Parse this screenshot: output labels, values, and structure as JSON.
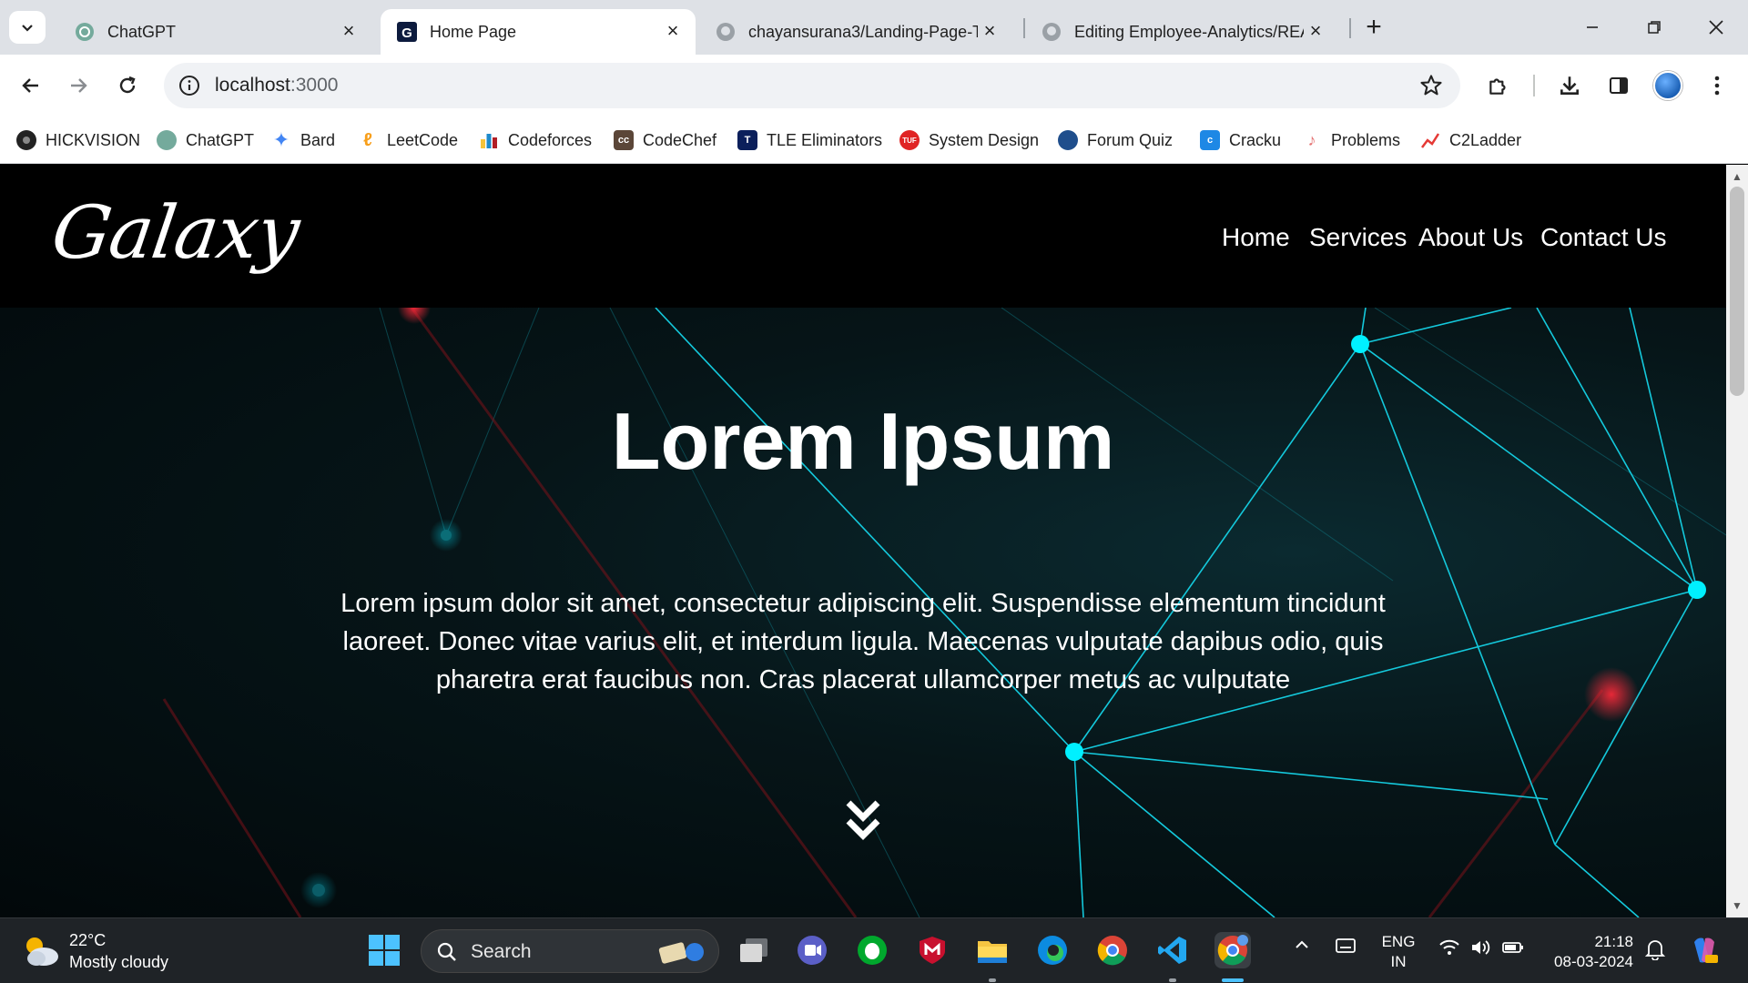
{
  "browser": {
    "tabs": [
      {
        "title": "ChatGPT",
        "icon": "chatgpt-icon",
        "active": false
      },
      {
        "title": "Home Page",
        "icon": "g-letter-icon",
        "active": true
      },
      {
        "title": "chayansurana3/Landing-Page-T",
        "icon": "github-icon",
        "active": false
      },
      {
        "title": "Editing Employee-Analytics/REA",
        "icon": "github-icon",
        "active": false
      }
    ],
    "address": {
      "host": "localhost",
      "port": ":3000"
    }
  },
  "bookmarks": [
    {
      "label": "HICKVISION",
      "icon": "camera-icon",
      "color": "#222222"
    },
    {
      "label": "ChatGPT",
      "icon": "chatgpt-icon",
      "color": "#74aa9c"
    },
    {
      "label": "Bard",
      "icon": "sparkle-icon",
      "color": "#4285f4"
    },
    {
      "label": "LeetCode",
      "icon": "leetcode-icon",
      "color": "#f89f1b"
    },
    {
      "label": "Codeforces",
      "icon": "bars-icon",
      "color": "#1f8acb"
    },
    {
      "label": "CodeChef",
      "icon": "codechef-icon",
      "color": "#5b4638"
    },
    {
      "label": "TLE Eliminators",
      "icon": "tle-icon",
      "color": "#0b1f5b"
    },
    {
      "label": "System Design",
      "icon": "tuf-icon",
      "color": "#e02424"
    },
    {
      "label": "Forum Quiz",
      "icon": "forum-icon",
      "color": "#1f4e8c"
    },
    {
      "label": "Cracku",
      "icon": "cracku-icon",
      "color": "#1e88e5"
    },
    {
      "label": "Problems",
      "icon": "problems-icon",
      "color": "#e57373"
    },
    {
      "label": "C2Ladder",
      "icon": "chart-icon",
      "color": "#e53935"
    }
  ],
  "site": {
    "logo": "Galaxy",
    "nav": [
      "Home",
      "Services",
      "About Us",
      "Contact Us"
    ],
    "hero_title": "Lorem Ipsum",
    "hero_text": "Lorem ipsum dolor sit amet, consectetur adipiscing elit. Suspendisse elementum tincidunt laoreet. Donec vitae varius elit, et interdum ligula. Maecenas vulputate dapibus odio, quis pharetra erat faucibus non. Cras placerat ullamcorper metus ac vulputate"
  },
  "taskbar": {
    "weather": {
      "temp": "22°C",
      "condition": "Mostly cloudy"
    },
    "search_label": "Search",
    "language": [
      "ENG",
      "IN"
    ],
    "time": "21:18",
    "date": "08-03-2024"
  },
  "colors": {
    "accent": "#00e5ff",
    "accent_red": "#ff2a3a"
  }
}
